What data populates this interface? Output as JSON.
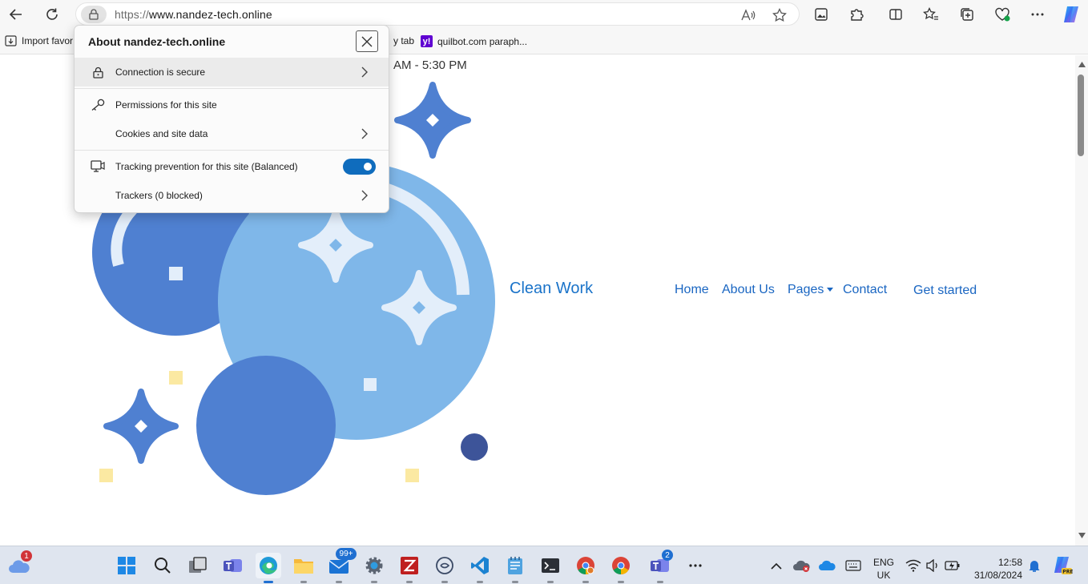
{
  "browser": {
    "url_protocol": "https://",
    "url_host": "www.nandez-tech.online",
    "favorites": [
      {
        "label": "Import favor"
      },
      {
        "label": "y tab"
      },
      {
        "label": "quilbot.com paraph..."
      }
    ]
  },
  "site_info": {
    "title": "About nandez-tech.online",
    "connection": "Connection is secure",
    "permissions": "Permissions for this site",
    "cookies": "Cookies and site data",
    "tracking": "Tracking prevention for this site (Balanced)",
    "tracking_enabled": true,
    "trackers": "Trackers (0 blocked)"
  },
  "page": {
    "hours_fragment": "AM - 5:30 PM",
    "brand": "Clean Work",
    "nav": [
      "Home",
      "About Us",
      "Pages",
      "Contact"
    ],
    "cta": "Get started"
  },
  "taskbar": {
    "weather_badge": "1",
    "mail_badge": "99+",
    "teams_badge": "2",
    "language_top": "ENG",
    "language_bottom": "UK",
    "time": "12:58",
    "date": "31/08/2024"
  },
  "colors": {
    "accent": "#0f6cbd",
    "link": "#1a66c2",
    "bubble_dark": "#4f80d1",
    "bubble_light": "#7fb7e9",
    "sparkle_light": "#e3eefa",
    "accent_yellow": "#fbe9a2",
    "dot_navy": "#3d5499"
  }
}
